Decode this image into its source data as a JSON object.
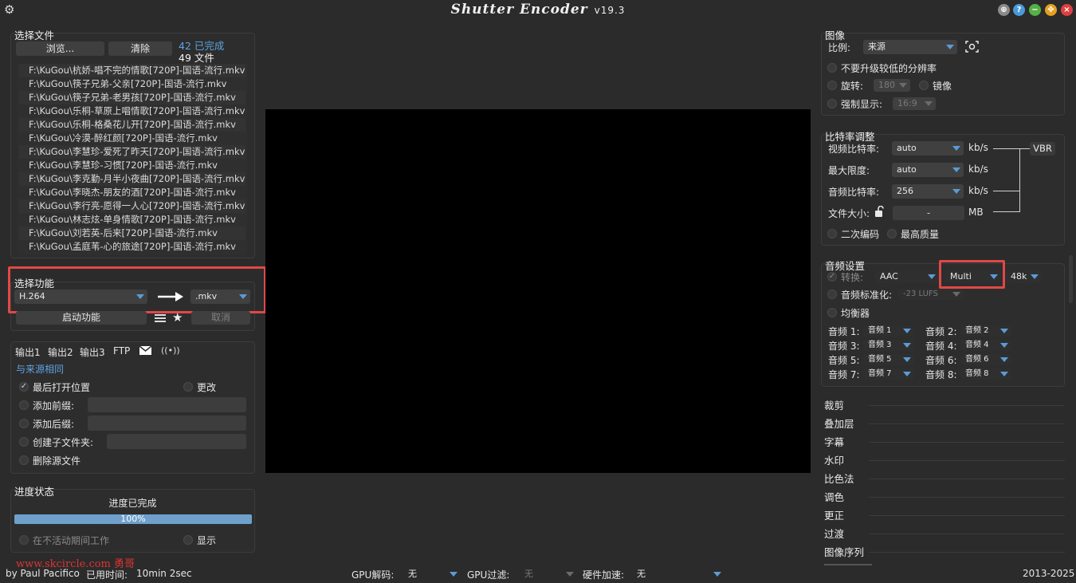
{
  "app": {
    "title": "Shutter Encoder",
    "version": "v19.3"
  },
  "titlebar": {
    "gear_icon": "gear-icon",
    "buttons": [
      "globe-icon",
      "help-icon",
      "minimize-icon",
      "maximize-icon",
      "close-icon"
    ]
  },
  "files": {
    "title": "选择文件",
    "browse_label": "浏览...",
    "clear_label": "清除",
    "done_count": "42 已完成",
    "total_count": "49 文件",
    "list": [
      "F:\\KuGou\\杭娇-唱不完的情歌[720P]-国语-流行.mkv",
      "F:\\KuGou\\筷子兄弟-父亲[720P]-国语-流行.mkv",
      "F:\\KuGou\\筷子兄弟-老男孩[720P]-国语-流行.mkv",
      "F:\\KuGou\\乐桐-草原上唱情歌[720P]-国语-流行.mkv",
      "F:\\KuGou\\乐桐-格桑花儿开[720P]-国语-流行.mkv",
      "F:\\KuGou\\冷漠-醉红颜[720P]-国语-流行.mkv",
      "F:\\KuGou\\李慧珍-爱死了昨天[720P]-国语-流行.mkv",
      "F:\\KuGou\\李慧珍-习惯[720P]-国语-流行.mkv",
      "F:\\KuGou\\李克勤-月半小夜曲[720P]-国语-流行.mkv",
      "F:\\KuGou\\李晓杰-朋友的酒[720P]-国语-流行.mkv",
      "F:\\KuGou\\李行亮-愿得一人心[720P]-国语-流行.mkv",
      "F:\\KuGou\\林志炫-单身情歌[720P]-国语-流行.mkv",
      "F:\\KuGou\\刘若英-后来[720P]-国语-流行.mkv",
      "F:\\KuGou\\孟庭苇-心的旅途[720P]-国语-流行.mkv"
    ]
  },
  "function": {
    "title": "选择功能",
    "codec": "H.264",
    "container": ".mkv",
    "start_label": "启动功能",
    "cancel_label": "取消"
  },
  "output": {
    "tabs": [
      "输出1",
      "输出2",
      "输出3",
      "FTP"
    ],
    "same_as_source": "与来源相同",
    "last_open_location": "最后打开位置",
    "change": "更改",
    "add_prefix": "添加前缀:",
    "add_suffix": "添加后缀:",
    "create_subfolder": "创建子文件夹:",
    "delete_source": "删除源文件"
  },
  "progress": {
    "title": "进度状态",
    "status": "进度已完成",
    "percent_text": "100%",
    "percent": 100,
    "work_when_idle": "在不活动期间工作",
    "show": "显示"
  },
  "watermark": "www.skcircle.com 勇哥",
  "footer": {
    "author": "by Paul Pacifico",
    "time_label": "已用时间:",
    "time_value": "10min 2sec",
    "gpu_decode_label": "GPU解码:",
    "gpu_decode_value": "无",
    "gpu_filter_label": "GPU过滤:",
    "gpu_filter_value": "无",
    "hw_accel_label": "硬件加速:",
    "hw_accel_value": "无",
    "years": "2013-2025"
  },
  "image": {
    "title": "图像",
    "ratio_label": "比例:",
    "ratio_value": "来源",
    "no_upscale": "不要升级较低的分辨率",
    "rotate_label": "旋转:",
    "rotate_value": "180",
    "mirror": "镜像",
    "force_display_label": "强制显示:",
    "force_display_value": "16:9"
  },
  "bitrate": {
    "title": "比特率调整",
    "video_label": "视频比特率:",
    "video_value": "auto",
    "max_label": "最大限度:",
    "max_value": "auto",
    "audio_label": "音频比特率:",
    "audio_value": "256",
    "size_label": "文件大小:",
    "size_value": "-",
    "unit_kbs": "kb/s",
    "unit_mb": "MB",
    "vbr": "VBR",
    "two_pass": "二次编码",
    "best_quality": "最高质量"
  },
  "audio": {
    "title": "音频设置",
    "convert_label": "转换:",
    "codec": "AAC",
    "layout": "Multi",
    "rate": "48k",
    "normalize_label": "音频标准化:",
    "normalize_value": "-23 LUFS",
    "equalizer": "均衡器",
    "tracks": [
      {
        "label": "音频 1:",
        "value": "音频 1"
      },
      {
        "label": "音频 2:",
        "value": "音频 2"
      },
      {
        "label": "音频 3:",
        "value": "音频 3"
      },
      {
        "label": "音频 4:",
        "value": "音频 4"
      },
      {
        "label": "音频 5:",
        "value": "音频 5"
      },
      {
        "label": "音频 6:",
        "value": "音频 6"
      },
      {
        "label": "音频 7:",
        "value": "音频 7"
      },
      {
        "label": "音频 8:",
        "value": "音频 8"
      }
    ]
  },
  "sections": [
    "裁剪",
    "叠加层",
    "字幕",
    "水印",
    "比色法",
    "调色",
    "更正",
    "过渡",
    "图像序列"
  ]
}
